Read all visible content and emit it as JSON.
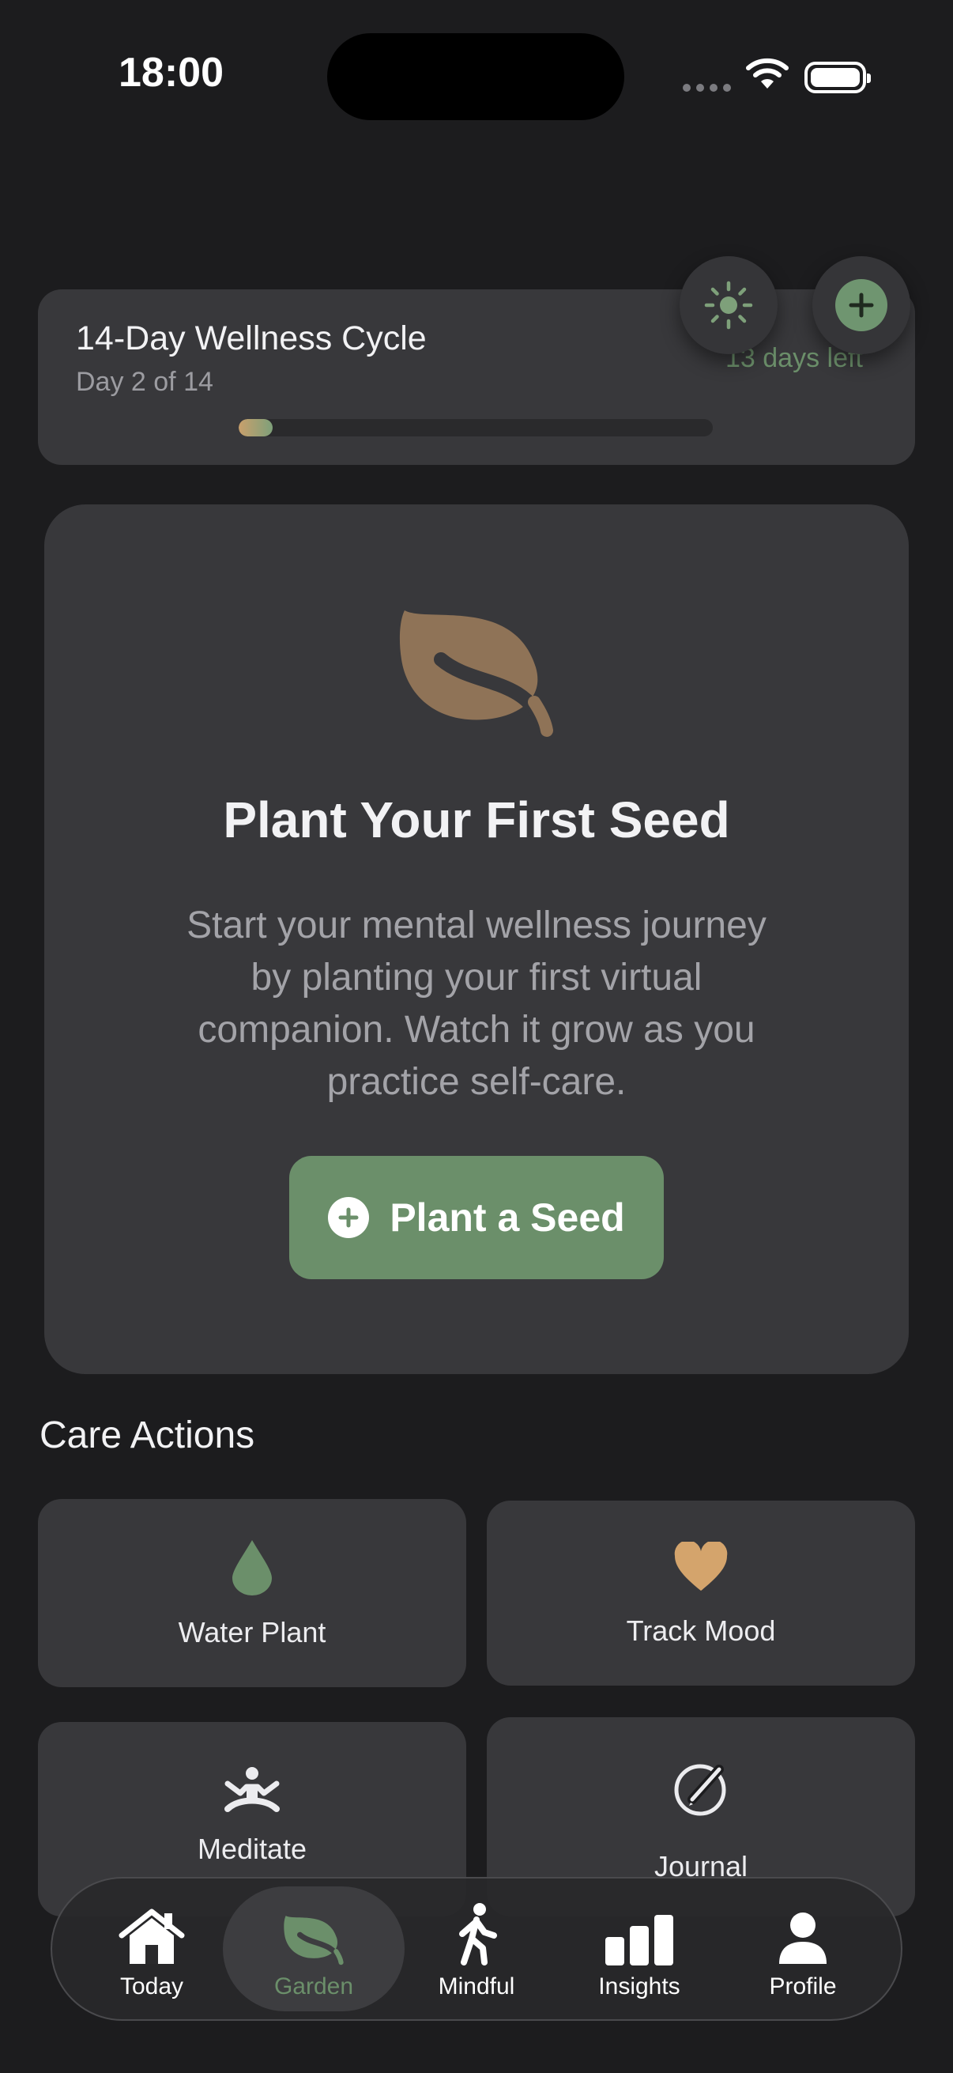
{
  "status_bar": {
    "time": "18:00"
  },
  "cycle": {
    "title": "14-Day Wellness Cycle",
    "subtitle": "Day 2 of 14",
    "days_left": "13 days left",
    "progress": 0.0714
  },
  "floating_buttons": {
    "theme_icon": "sun-icon",
    "add_icon": "plus-icon"
  },
  "empty_state": {
    "icon": "leaf-icon",
    "title": "Plant Your First Seed",
    "body": "Start your mental wellness journey by planting your first virtual companion. Watch it grow as you practice self-care.",
    "button_label": "Plant a Seed"
  },
  "care_actions": {
    "title": "Care Actions",
    "items": [
      {
        "label": "Water Plant",
        "icon": "water-drop-icon"
      },
      {
        "label": "Track Mood",
        "icon": "heart-icon"
      },
      {
        "label": "Meditate",
        "icon": "meditation-icon"
      },
      {
        "label": "Journal",
        "icon": "journal-icon"
      }
    ]
  },
  "tab_bar": {
    "active": "Garden",
    "tabs": [
      {
        "label": "Today",
        "icon": "home-icon"
      },
      {
        "label": "Garden",
        "icon": "leaf-icon"
      },
      {
        "label": "Mindful",
        "icon": "walking-icon"
      },
      {
        "label": "Insights",
        "icon": "bar-chart-icon"
      },
      {
        "label": "Profile",
        "icon": "person-icon"
      }
    ]
  },
  "colors": {
    "background": "#1c1c1e",
    "card": "#38383b",
    "accent_green": "#6b8f6a",
    "accent_tan": "#8f7357",
    "heart": "#d4a46c"
  }
}
